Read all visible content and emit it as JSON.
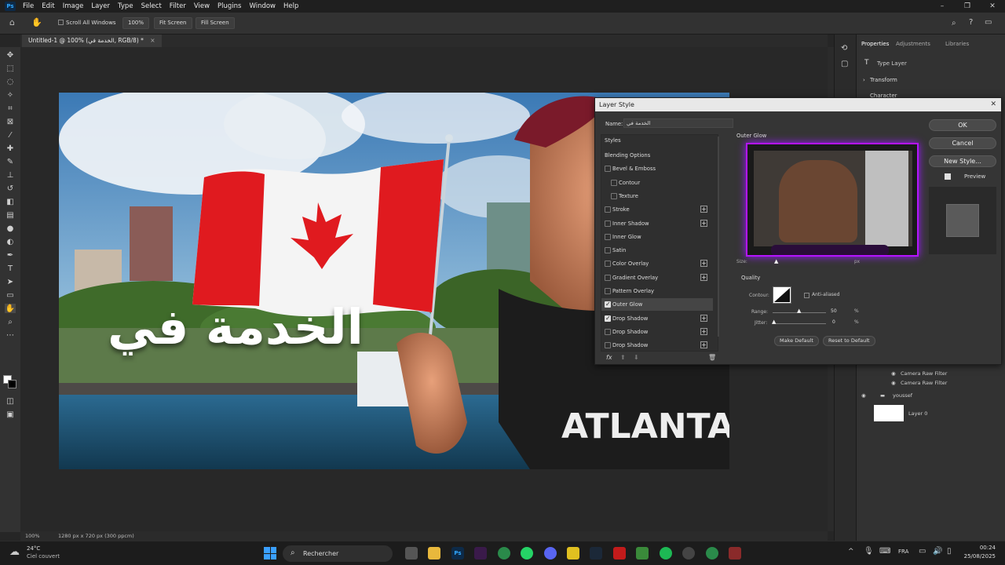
{
  "menubar": {
    "items": [
      "File",
      "Edit",
      "Image",
      "Layer",
      "Type",
      "Select",
      "Filter",
      "View",
      "Plugins",
      "Window",
      "Help"
    ]
  },
  "options_bar": {
    "scroll_all_windows": "Scroll All Windows",
    "zoom": "100%",
    "fit_screen": "Fit Screen",
    "fill_screen": "Fill Screen"
  },
  "document": {
    "tab_title": "Untitled-1 @ 100% (الخدمة في, RGB/8) *",
    "artwork_text": "الخدمة في"
  },
  "status": {
    "zoom": "100%",
    "doc_info": "1280 px x 720 px (300 ppcm)"
  },
  "properties": {
    "tabs": [
      "Properties",
      "Adjustments",
      "Libraries"
    ],
    "type_layer": "Type Layer",
    "transform": "Transform",
    "character": "Character"
  },
  "layers": {
    "rows": [
      {
        "label": "Camera Raw Filter"
      },
      {
        "label": "Camera Raw Filter"
      },
      {
        "label": "youssef"
      },
      {
        "label": "Layer 0"
      }
    ]
  },
  "dialog": {
    "title": "Layer Style",
    "name_label": "Name:",
    "name_value": "الخدمة في",
    "styles_header": "Styles",
    "styles": [
      {
        "label": "Blending Options",
        "checkbox": false,
        "plus": false,
        "selected": false,
        "indent": 0
      },
      {
        "label": "Bevel & Emboss",
        "checkbox": true,
        "checked": false,
        "plus": false,
        "indent": 0
      },
      {
        "label": "Contour",
        "checkbox": true,
        "checked": false,
        "plus": false,
        "indent": 1
      },
      {
        "label": "Texture",
        "checkbox": true,
        "checked": false,
        "plus": false,
        "indent": 1
      },
      {
        "label": "Stroke",
        "checkbox": true,
        "checked": false,
        "plus": true,
        "indent": 0
      },
      {
        "label": "Inner Shadow",
        "checkbox": true,
        "checked": false,
        "plus": true,
        "indent": 0
      },
      {
        "label": "Inner Glow",
        "checkbox": true,
        "checked": false,
        "plus": false,
        "indent": 0
      },
      {
        "label": "Satin",
        "checkbox": true,
        "checked": false,
        "plus": false,
        "indent": 0
      },
      {
        "label": "Color Overlay",
        "checkbox": true,
        "checked": false,
        "plus": true,
        "indent": 0
      },
      {
        "label": "Gradient Overlay",
        "checkbox": true,
        "checked": false,
        "plus": true,
        "indent": 0
      },
      {
        "label": "Pattern Overlay",
        "checkbox": true,
        "checked": false,
        "plus": false,
        "indent": 0
      },
      {
        "label": "Outer Glow",
        "checkbox": true,
        "checked": true,
        "plus": false,
        "selected": true,
        "indent": 0
      },
      {
        "label": "Drop Shadow",
        "checkbox": true,
        "checked": true,
        "plus": true,
        "indent": 0
      },
      {
        "label": "Drop Shadow",
        "checkbox": true,
        "checked": false,
        "plus": true,
        "indent": 0
      },
      {
        "label": "Drop Shadow",
        "checkbox": true,
        "checked": false,
        "plus": true,
        "indent": 0
      }
    ],
    "section_title": "Outer Glow",
    "quality_title": "Quality",
    "contour_label": "Contour:",
    "anti_aliased": "Anti-aliased",
    "range_label": "Range:",
    "range_value": "50",
    "jitter_label": "Jitter:",
    "jitter_value": "0",
    "percent": "%",
    "size_label": "Size:",
    "px": "px",
    "make_default": "Make Default",
    "reset_default": "Reset to Default",
    "ok": "OK",
    "cancel": "Cancel",
    "new_style": "New Style...",
    "preview": "Preview",
    "fx": "fx"
  },
  "taskbar": {
    "weather_temp": "24°C",
    "weather_desc": "Ciel couvert",
    "search": "Rechercher",
    "lang": "FRA",
    "time": "00:24",
    "date": "25/08/2025"
  },
  "colors": {
    "app_bg": "#282828",
    "panel": "#323232",
    "dialog": "#353535",
    "accent": "#31a8ff",
    "glow": "#9b1cff"
  }
}
